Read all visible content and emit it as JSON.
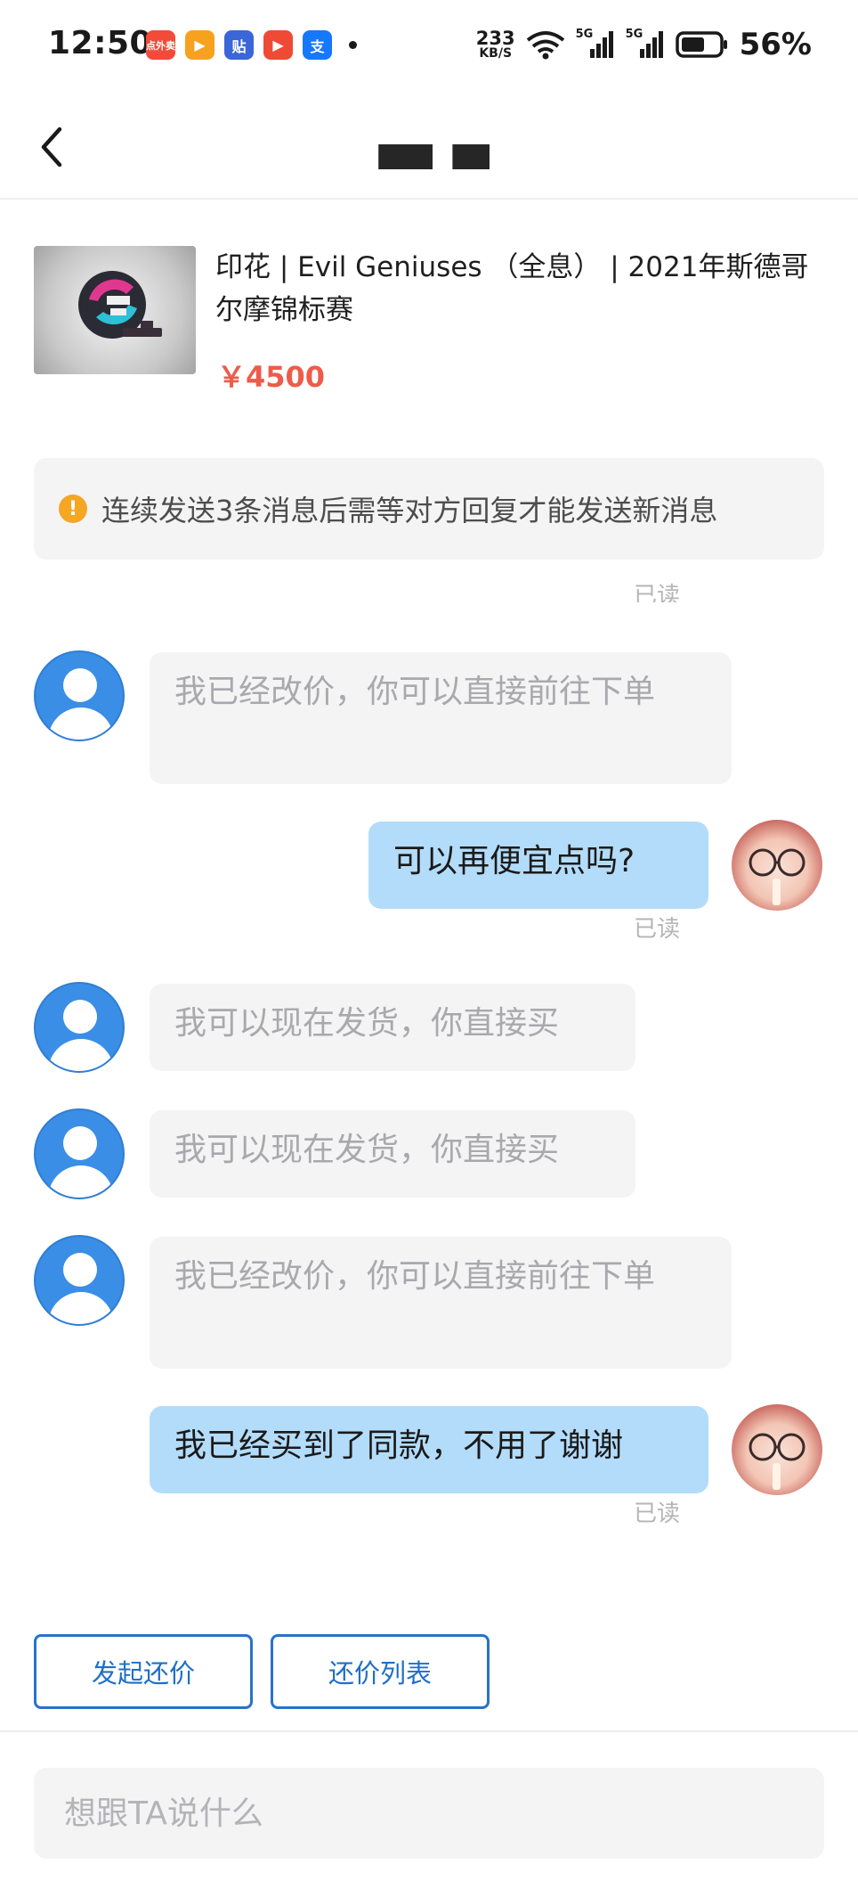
{
  "status_bar": {
    "time": "12:50",
    "apps": [
      {
        "name": "app-icon-waimai",
        "label": "点外卖",
        "color": "#f24b3a"
      },
      {
        "name": "app-icon-video",
        "label": "▶",
        "color": "#f6a21e"
      },
      {
        "name": "app-icon-tieba",
        "label": "贴",
        "color": "#3b66d8"
      },
      {
        "name": "app-icon-youku",
        "label": "▶",
        "color": "#ef4a36"
      },
      {
        "name": "app-icon-alipay",
        "label": "支",
        "color": "#1677ff"
      }
    ],
    "net_speed_value": "233",
    "net_speed_unit": "KB/S",
    "signal_1": "5G",
    "signal_2": "5G",
    "battery_percent": "56%"
  },
  "header": {
    "back_icon": "chevron-left-icon",
    "title": ""
  },
  "product": {
    "title": "印花 | Evil Geniuses （全息） | 2021年斯德哥尔摩锦标赛",
    "price": "￥4500"
  },
  "notice": {
    "icon": "warning-icon",
    "text": "连续发送3条消息后需等对方回复才能发送新消息"
  },
  "messages": {
    "read_top": "已读",
    "m1": "我已经改价，你可以直接前往下单",
    "m2": "可以再便宜点吗?",
    "m2_read": "已读",
    "m3": "我可以现在发货，你直接买",
    "m4": "我可以现在发货，你直接买",
    "m5": "我已经改价，你可以直接前往下单",
    "m6": "我已经买到了同款，不用了谢谢",
    "m6_read": "已读"
  },
  "actions": {
    "offer_button": "发起还价",
    "offer_list_button": "还价列表"
  },
  "input": {
    "placeholder": "想跟TA说什么"
  },
  "colors": {
    "accent_blue": "#1f6fc6",
    "price_red": "#ee5b4a",
    "outgoing_bubble": "#b3dcfa",
    "incoming_bubble": "#f4f4f5",
    "warning": "#f5a623"
  }
}
